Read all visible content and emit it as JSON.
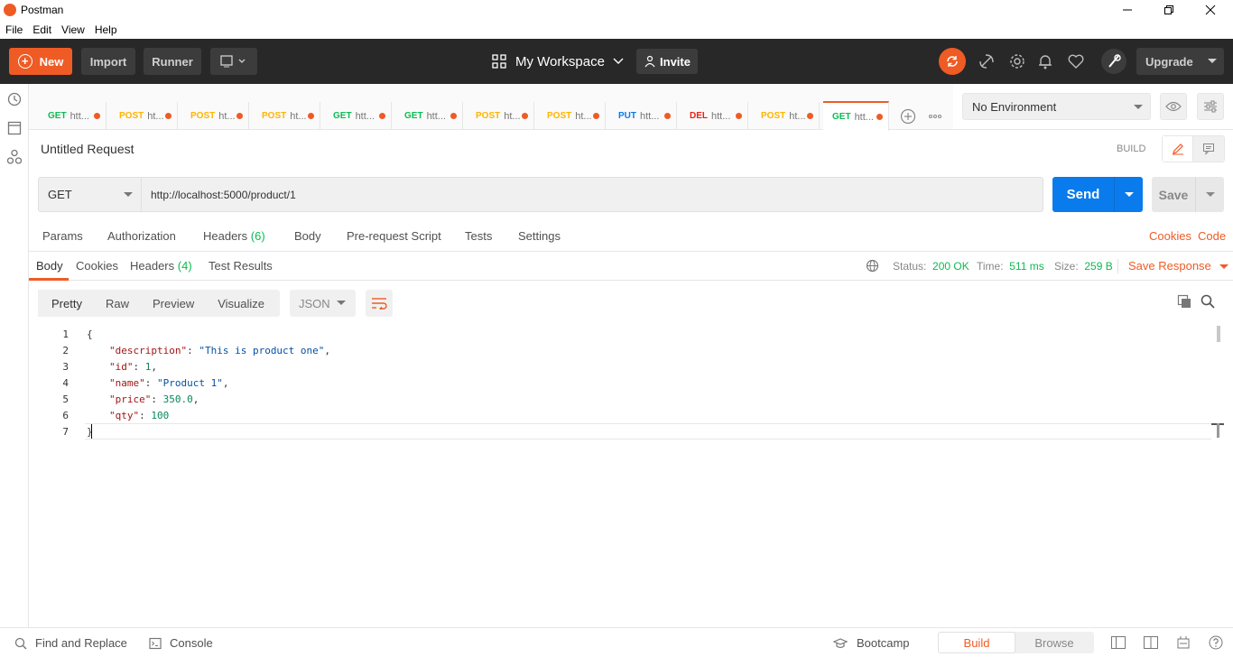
{
  "window": {
    "title": "Postman"
  },
  "menu": [
    "File",
    "Edit",
    "View",
    "Help"
  ],
  "header": {
    "new_label": "New",
    "import_label": "Import",
    "runner_label": "Runner",
    "workspace": "My Workspace",
    "invite": "Invite",
    "upgrade": "Upgrade"
  },
  "tabs": [
    {
      "method": "GET",
      "url": "htt..."
    },
    {
      "method": "POST",
      "url": "ht..."
    },
    {
      "method": "POST",
      "url": "ht..."
    },
    {
      "method": "POST",
      "url": "ht..."
    },
    {
      "method": "GET",
      "url": "htt..."
    },
    {
      "method": "GET",
      "url": "htt..."
    },
    {
      "method": "POST",
      "url": "ht..."
    },
    {
      "method": "POST",
      "url": "ht..."
    },
    {
      "method": "PUT",
      "url": "htt..."
    },
    {
      "method": "DEL",
      "url": "htt..."
    },
    {
      "method": "POST",
      "url": "ht..."
    },
    {
      "method": "GET",
      "url": "htt...",
      "active": true
    }
  ],
  "environment": "No Environment",
  "request": {
    "title": "Untitled Request",
    "build_label": "BUILD",
    "method": "GET",
    "url": "http://localhost:5000/product/1",
    "send": "Send",
    "save": "Save",
    "tabs": {
      "params": "Params",
      "authorization": "Authorization",
      "headers": "Headers",
      "headers_count": "(6)",
      "body": "Body",
      "prerequest": "Pre-request Script",
      "tests": "Tests",
      "settings": "Settings"
    },
    "cookies": "Cookies",
    "code": "Code"
  },
  "response": {
    "tabs": {
      "body": "Body",
      "cookies": "Cookies",
      "headers": "Headers",
      "headers_count": "(4)",
      "test_results": "Test Results"
    },
    "status_label": "Status:",
    "status": "200 OK",
    "time_label": "Time:",
    "time": "511 ms",
    "size_label": "Size:",
    "size": "259 B",
    "save_response": "Save Response",
    "views": [
      "Pretty",
      "Raw",
      "Preview",
      "Visualize"
    ],
    "format": "JSON",
    "lines": [
      {
        "n": "1",
        "text": "{"
      },
      {
        "n": "2",
        "key": "\"description\"",
        "val": "\"This is product one\"",
        "type": "s",
        "comma": true
      },
      {
        "n": "3",
        "key": "\"id\"",
        "val": "1",
        "type": "n",
        "comma": true
      },
      {
        "n": "4",
        "key": "\"name\"",
        "val": "\"Product 1\"",
        "type": "s",
        "comma": true
      },
      {
        "n": "5",
        "key": "\"price\"",
        "val": "350.0",
        "type": "n",
        "comma": true
      },
      {
        "n": "6",
        "key": "\"qty\"",
        "val": "100",
        "type": "n",
        "comma": false
      },
      {
        "n": "7",
        "text": "}"
      }
    ]
  },
  "statusbar": {
    "find_replace": "Find and Replace",
    "console": "Console",
    "bootcamp": "Bootcamp",
    "build": "Build",
    "browse": "Browse"
  }
}
